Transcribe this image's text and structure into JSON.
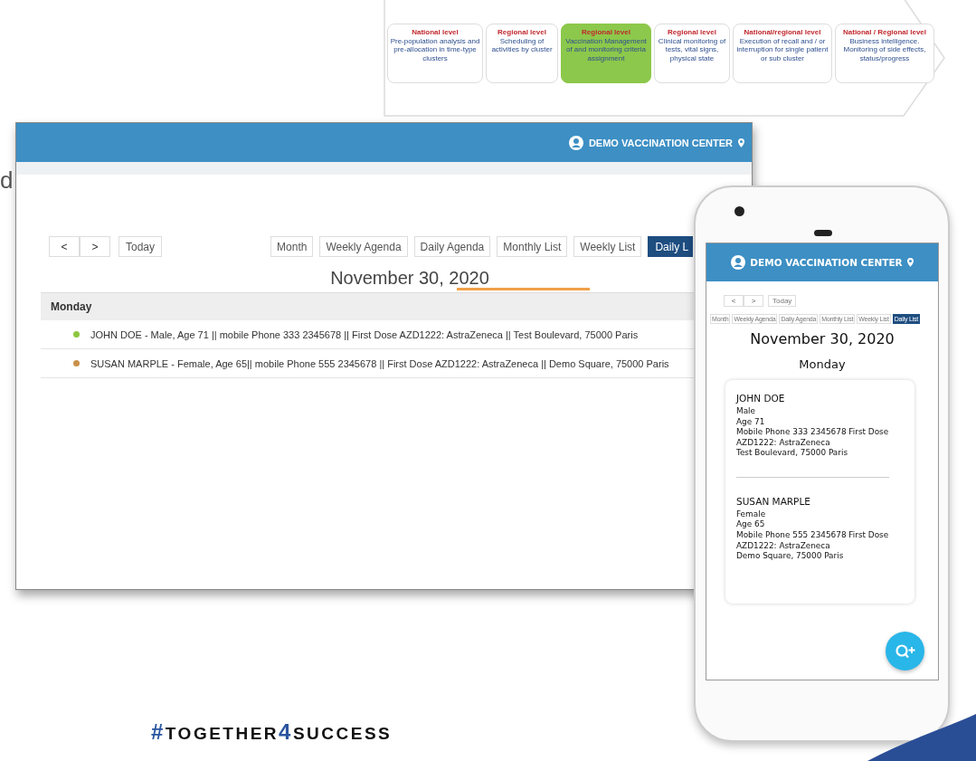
{
  "slide_fragments": [
    "d"
  ],
  "process_flow": [
    {
      "level": "National level",
      "description": "Pre-population analysis and pre-allocation in time-type clusters",
      "selected": false
    },
    {
      "level": "Regional level",
      "description": "Scheduling of activities by cluster",
      "selected": false
    },
    {
      "level": "Regional level",
      "description": "Vaccination Management of and monitoring criteria assignment",
      "selected": true
    },
    {
      "level": "Regional level",
      "description": "Clinical monitoring of tests, vital signs, physical state",
      "selected": false
    },
    {
      "level": "National/regional level",
      "description": "Execution of recall and / or interruption for single patient or sub cluster",
      "selected": false
    },
    {
      "level": "National / Regional level",
      "description": "Business intelligence. Monitoring of side effects, status/progress",
      "selected": false
    }
  ],
  "desktop": {
    "center": "DEMO VACCINATION CENTER",
    "nav": [
      "<",
      ">"
    ],
    "today": "Today",
    "view_tabs": [
      {
        "label": "Month",
        "selected": false
      },
      {
        "label": "Weekly Agenda",
        "selected": false
      },
      {
        "label": "Daily Agenda",
        "selected": false
      },
      {
        "label": "Monthly List",
        "selected": false
      },
      {
        "label": "Weekly List",
        "selected": false
      },
      {
        "label": "Daily L",
        "selected": true
      }
    ],
    "date": "November 30, 2020",
    "day": "Monday",
    "events": [
      {
        "text": "JOHN DOE - Male, Age 71 || mobile Phone 333 2345678 || First Dose AZD1222: AstraZeneca || Test Boulevard, 75000 Paris",
        "color": "#8dc63f"
      },
      {
        "text": "SUSAN MARPLE - Female, Age 65|| mobile Phone 555 2345678 || First Dose AZD1222: AstraZeneca || Demo Square, 75000 Paris",
        "color": "#c8914a"
      }
    ]
  },
  "phone": {
    "center": "DEMO VACCINATION CENTER",
    "nav": [
      "<",
      ">"
    ],
    "today": "Today",
    "view_tabs": [
      {
        "label": "Month",
        "selected": false
      },
      {
        "label": "Weekly Agenda",
        "selected": false
      },
      {
        "label": "Daily Agenda",
        "selected": false
      },
      {
        "label": "Monthly List",
        "selected": false
      },
      {
        "label": "Weekly List",
        "selected": false
      },
      {
        "label": "Daily List",
        "selected": true
      }
    ],
    "date": "November 30, 2020",
    "day": "Monday",
    "entries": [
      {
        "name": "JOHN DOE",
        "details": [
          "Male",
          "Age 71",
          "Mobile Phone 333 2345678 First Dose AZD1222: AstraZeneca",
          "Test Boulevard, 75000 Paris"
        ]
      },
      {
        "name": "SUSAN MARPLE",
        "details": [
          "Female",
          "Age 65",
          "Mobile Phone 555 2345678 First Dose AZD1222: AstraZeneca",
          "Demo Square, 75000 Paris"
        ]
      }
    ]
  },
  "logo": [
    {
      "text": "#",
      "accent": true
    },
    {
      "text": "TOGETHER",
      "accent": false
    },
    {
      "text": "4",
      "accent": true
    },
    {
      "text": "SUCCESS",
      "accent": false
    }
  ]
}
